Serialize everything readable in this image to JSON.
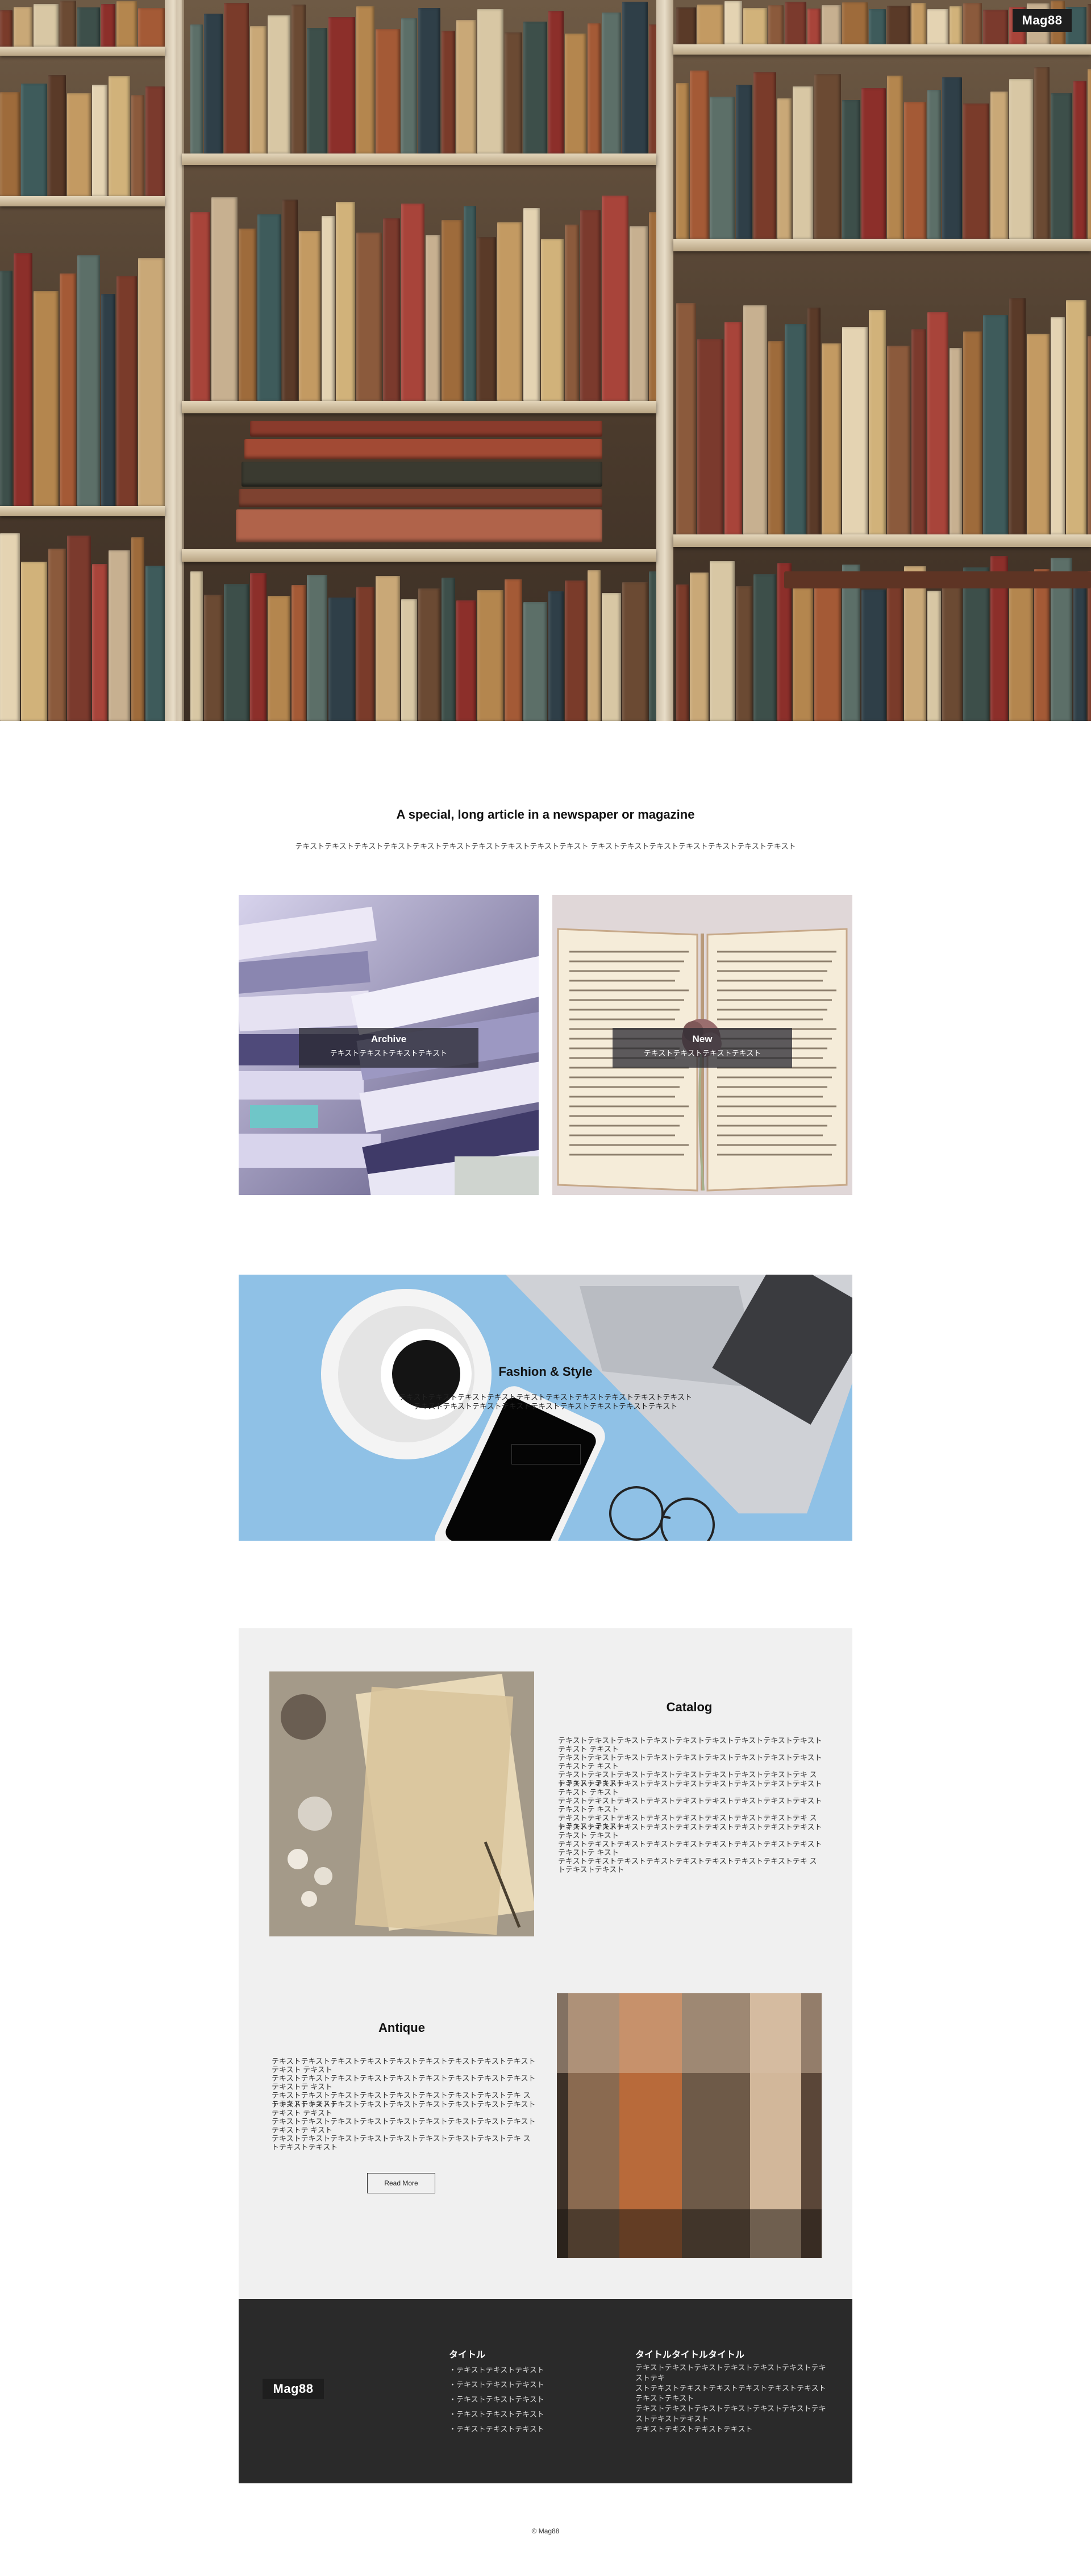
{
  "brand": {
    "logo_text": "Mag88"
  },
  "intro": {
    "title": "A special, long article in a newspaper or magazine",
    "subtitle": "テキストテキストテキストテキストテキストテキストテキストテキストテキストテキスト テキストテキストテキストテキストテキストテキストテキスト"
  },
  "cards": [
    {
      "title": "Archive",
      "text": "テキストテキストテキストテキスト"
    },
    {
      "title": "New",
      "text": "テキストテキストテキストテキスト"
    }
  ],
  "fashion": {
    "title": "Fashion & Style",
    "lines": [
      "テキストテキストテキストテキストテキストテキストテキストテキストテキストテキスト",
      "テキストテキストテキストテキストテキストテキストテキストテキストテキスト"
    ]
  },
  "catalog": {
    "title": "Catalog",
    "paragraphs": [
      [
        "テキストテキストテキストテキストテキストテキストテキストテキストテキストテキスト テキスト",
        "テキストテキストテキストテキストテキストテキストテキストテキストテキストテキストテ キスト",
        "テキストテキストテキストテキストテキストテキストテキストテキストテキ ストテキストテキスト"
      ],
      [
        "テキストテキストテキストテキストテキストテキストテキストテキストテキストテキスト テキスト",
        "テキストテキストテキストテキストテキストテキストテキストテキストテキストテキストテ キスト",
        "テキストテキストテキストテキストテキストテキストテキストテキストテキ ストテキストテキスト"
      ],
      [
        "テキストテキストテキストテキストテキストテキストテキストテキストテキストテキスト テキスト",
        "テキストテキストテキストテキストテキストテキストテキストテキストテキストテキストテ キスト",
        "テキストテキストテキストテキストテキストテキストテキストテキストテキ ストテキストテキスト"
      ]
    ]
  },
  "antique": {
    "title": "Antique",
    "paragraphs": [
      [
        "テキストテキストテキストテキストテキストテキストテキストテキストテキストテキスト テキスト",
        "テキストテキストテキストテキストテキストテキストテキストテキストテキストテキストテ キスト",
        "テキストテキストテキストテキストテキストテキストテキストテキストテキ ストテキストテキスト"
      ],
      [
        "テキストテキストテキストテキストテキストテキストテキストテキストテキストテキスト テキスト",
        "テキストテキストテキストテキストテキストテキストテキストテキストテキストテキストテ キスト",
        "テキストテキストテキストテキストテキストテキストテキストテキストテキ ストテキストテキスト"
      ]
    ],
    "button_label": "Read More"
  },
  "footer": {
    "logo_text": "Mag88",
    "col1": {
      "heading": "タイトル",
      "items": [
        "・テキストテキストテキスト",
        "・テキストテキストテキスト",
        "・テキストテキストテキスト",
        "・テキストテキストテキスト",
        "・テキストテキストテキスト"
      ]
    },
    "col2": {
      "heading": "タイトルタイトルタイトル",
      "lines": [
        "テキストテキストテキストテキストテキストテキストテキストテキ",
        "ストテキストテキストテキストテキストテキストテキストテキストテキスト",
        "テキストテキストテキストテキストテキストテキストテキストテキストテキスト",
        "テキストテキストテキストテキスト"
      ]
    },
    "copyright": "© Mag88"
  },
  "colors": {
    "footer_bg": "#2a2a2a",
    "panel_bg": "#f0f0f0",
    "fashion_bg": "#8fc1e6",
    "logo_bg": "#1e1e1e"
  }
}
